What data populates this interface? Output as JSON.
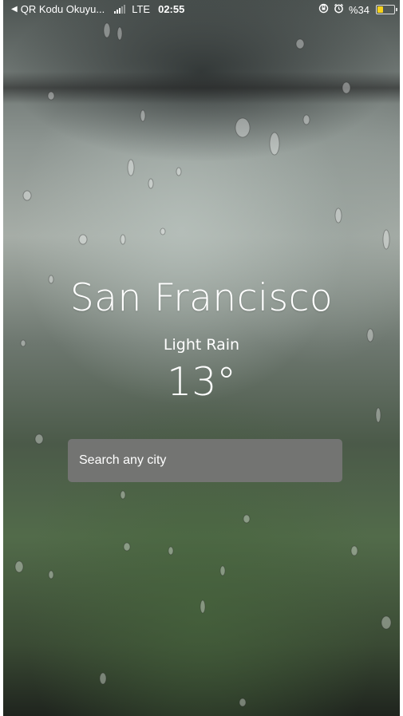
{
  "status_bar": {
    "back_app": "QR Kodu Okuyu...",
    "network": "LTE",
    "time": "02:55",
    "battery": "%34",
    "battery_level": 0.34,
    "icons": [
      "back-arrow-icon",
      "signal-icon",
      "rotation-lock-icon",
      "alarm-icon",
      "battery-icon"
    ]
  },
  "weather": {
    "city": "San Francisco",
    "condition": "Light Rain",
    "temperature": "13°"
  },
  "search": {
    "placeholder": "Search any city",
    "value": ""
  },
  "colors": {
    "battery_fill": "#f7d21b",
    "search_bg": "#767676",
    "text": "#ffffff"
  }
}
